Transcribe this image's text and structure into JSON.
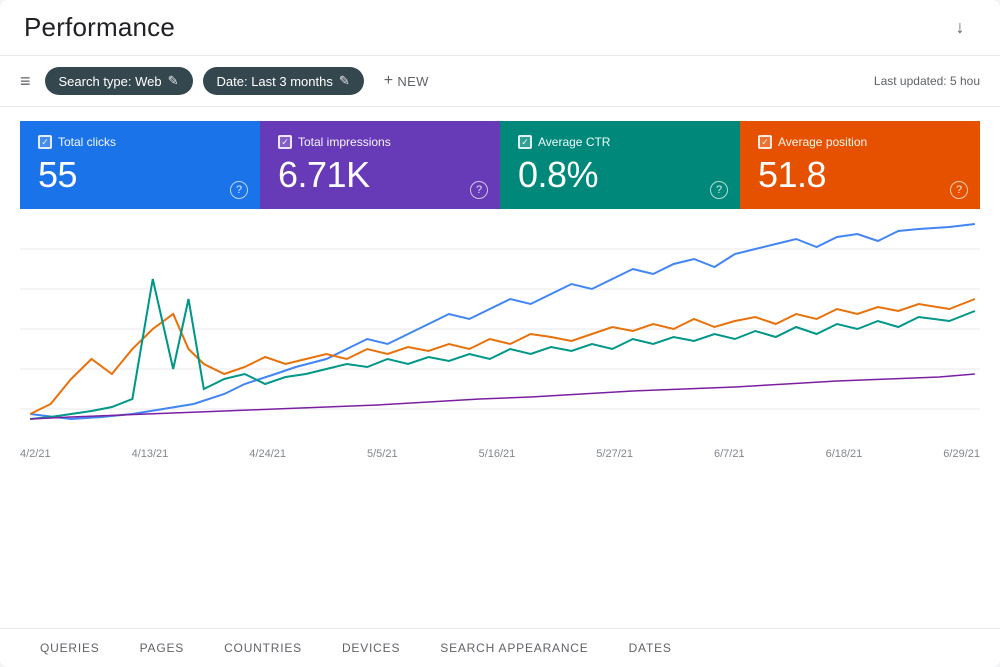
{
  "page": {
    "title": "Performance",
    "last_updated": "Last updated: 5 hou",
    "download_icon": "↓"
  },
  "toolbar": {
    "filter_icon": "≡",
    "chips": [
      {
        "label": "Search type: Web",
        "icon": "✎"
      },
      {
        "label": "Date: Last 3 months",
        "icon": "✎"
      }
    ],
    "new_button": "NEW",
    "plus_icon": "+"
  },
  "metrics": [
    {
      "id": "total-clicks",
      "label": "Total clicks",
      "value": "55",
      "color": "blue"
    },
    {
      "id": "total-impressions",
      "label": "Total impressions",
      "value": "6.71K",
      "color": "purple"
    },
    {
      "id": "average-ctr",
      "label": "Average CTR",
      "value": "0.8%",
      "color": "teal"
    },
    {
      "id": "average-position",
      "label": "Average position",
      "value": "51.8",
      "color": "orange"
    }
  ],
  "chart": {
    "x_labels": [
      "4/2/21",
      "4/13/21",
      "4/24/21",
      "5/5/21",
      "5/16/21",
      "5/27/21",
      "6/7/21",
      "6/18/21",
      "6/29/21"
    ],
    "colors": {
      "blue": "#4285f4",
      "orange": "#e8710a",
      "teal": "#009688",
      "purple": "#7b1fa2"
    }
  },
  "bottom_tabs": [
    {
      "label": "QUERIES",
      "active": false
    },
    {
      "label": "PAGES",
      "active": false
    },
    {
      "label": "COUNTRIES",
      "active": false
    },
    {
      "label": "DEVICES",
      "active": false
    },
    {
      "label": "SEARCH APPEARANCE",
      "active": false
    },
    {
      "label": "DATES",
      "active": false
    }
  ]
}
